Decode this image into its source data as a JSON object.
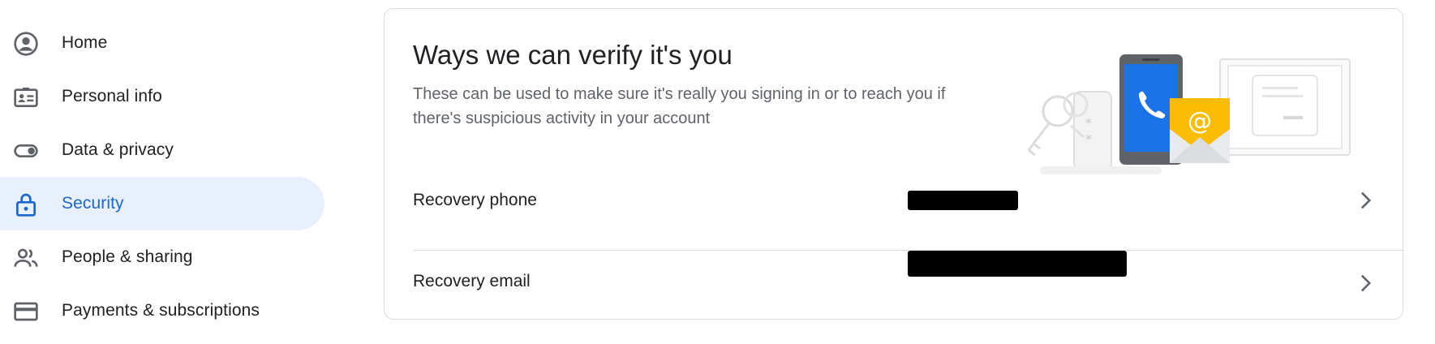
{
  "sidebar": {
    "items": [
      {
        "label": "Home",
        "icon": "account-circle-icon",
        "active": false
      },
      {
        "label": "Personal info",
        "icon": "id-card-icon",
        "active": false
      },
      {
        "label": "Data & privacy",
        "icon": "toggle-icon",
        "active": false
      },
      {
        "label": "Security",
        "icon": "lock-icon",
        "active": true
      },
      {
        "label": "People & sharing",
        "icon": "people-icon",
        "active": false
      },
      {
        "label": "Payments & subscriptions",
        "icon": "credit-card-icon",
        "active": false
      }
    ]
  },
  "card": {
    "title": "Ways we can verify it's you",
    "description": "These can be used to make sure it's really you signing in or to reach you if there's suspicious activity in your account",
    "rows": [
      {
        "label": "Recovery phone",
        "value_redacted": true
      },
      {
        "label": "Recovery email",
        "value_redacted": true
      }
    ]
  },
  "colors": {
    "accent": "#1967d2",
    "active_bg": "#e8f0fe",
    "phone_blue": "#1a73e8",
    "envelope_yellow": "#fbbc04"
  }
}
